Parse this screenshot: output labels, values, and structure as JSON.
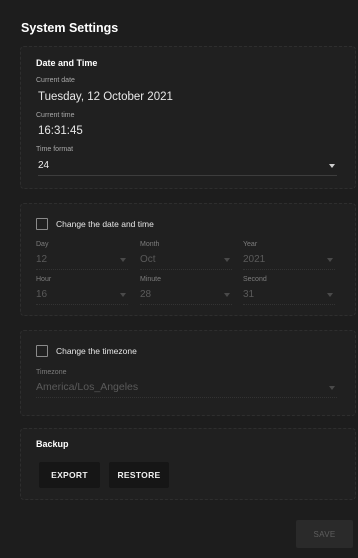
{
  "page": {
    "title": "System Settings"
  },
  "date_time": {
    "title": "Date and Time",
    "current_date_label": "Current date",
    "current_date": "Tuesday, 12 October 2021",
    "current_time_label": "Current time",
    "current_time": "16:31:45",
    "time_format_label": "Time format",
    "time_format": "24"
  },
  "change_date": {
    "checkbox_label": "Change the date and time",
    "checked": false,
    "day_label": "Day",
    "day": "12",
    "month_label": "Month",
    "month": "Oct",
    "year_label": "Year",
    "year": "2021",
    "hour_label": "Hour",
    "hour": "16",
    "minute_label": "Minute",
    "minute": "28",
    "second_label": "Second",
    "second": "31"
  },
  "timezone": {
    "checkbox_label": "Change the timezone",
    "checked": false,
    "timezone_label": "Timezone",
    "timezone": "America/Los_Angeles"
  },
  "backup": {
    "title": "Backup",
    "export_label": "EXPORT",
    "restore_label": "RESTORE"
  },
  "footer": {
    "save_label": "SAVE"
  },
  "colors": {
    "background": "#1d1d1d",
    "card": "#202020",
    "button": "#161616",
    "disabled_text": "#5a5a5a"
  },
  "icons": {
    "dropdown": "caret-down-icon",
    "checkbox": "checkbox-unchecked-icon"
  }
}
